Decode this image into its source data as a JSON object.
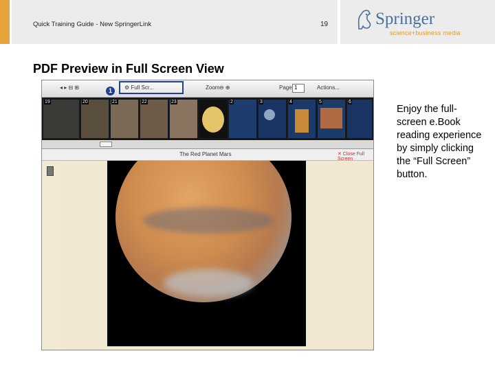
{
  "header": {
    "guide_title": "Quick Training Guide - New SpringerLink",
    "page_number": "19",
    "logo": {
      "name": "Springer",
      "tagline": "science+business media"
    }
  },
  "slide": {
    "title": "PDF Preview in Full Screen View",
    "description": "Enjoy the full-screen e.Book reading experience by simply clicking the “Full Screen” button."
  },
  "screenshot": {
    "toolbar": {
      "nav_label": "◂ ▸ ⊟ ⊞",
      "full_screen_label": "⚙ Full Scr...",
      "zoom_label": "Zoom",
      "zoom_controls": "⊖ ⊕",
      "page_label": "Page",
      "page_value": "1",
      "share_label": "Actions...",
      "marker": "1"
    },
    "thumbnails": [
      {
        "num": "19"
      },
      {
        "num": "20"
      },
      {
        "num": "21"
      },
      {
        "num": "22"
      },
      {
        "num": "23"
      },
      {
        "num": ""
      },
      {
        "num": "2"
      },
      {
        "num": "3"
      },
      {
        "num": "4"
      },
      {
        "num": "5"
      },
      {
        "num": "6"
      }
    ],
    "view_title": "The Red Planet Mars",
    "view_link": "✕ Close Full Screen",
    "colors": {
      "highlight": "#1f3f96",
      "accent": "#e8a33b",
      "logo_blue": "#4a6f9a",
      "logo_orange": "#e39a2f"
    }
  }
}
